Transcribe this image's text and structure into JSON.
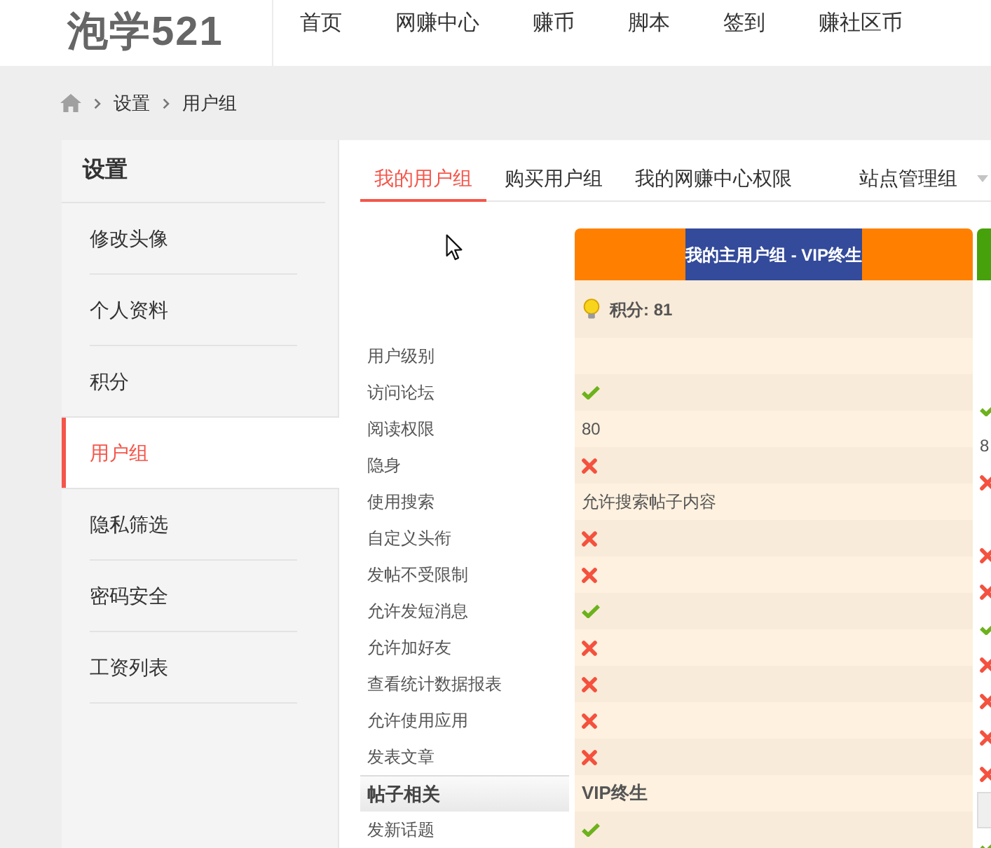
{
  "header": {
    "logo": "泡学521",
    "nav": [
      "首页",
      "网赚中心",
      "赚币",
      "脚本",
      "签到",
      "赚社区币"
    ]
  },
  "breadcrumb": [
    "设置",
    "用户组"
  ],
  "sidebar": {
    "title": "设置",
    "items": [
      {
        "label": "修改头像",
        "selected": false
      },
      {
        "label": "个人资料",
        "selected": false
      },
      {
        "label": "积分",
        "selected": false
      },
      {
        "label": "用户组",
        "selected": true
      },
      {
        "label": "隐私筛选",
        "selected": false
      },
      {
        "label": "密码安全",
        "selected": false
      },
      {
        "label": "工资列表",
        "selected": false
      }
    ]
  },
  "tabs": [
    {
      "label": "我的用户组",
      "selected": true,
      "kind": "tab"
    },
    {
      "label": "购买用户组",
      "selected": false,
      "kind": "tab"
    },
    {
      "label": "我的网赚中心权限",
      "selected": false,
      "kind": "tab"
    },
    {
      "label": "站点管理组",
      "selected": false,
      "kind": "dropdown"
    }
  ],
  "table": {
    "groups": [
      {
        "title": "我的主用户组 - VIP终生",
        "color": "#ff8000",
        "points": "积分: 81"
      },
      {
        "color": "#46a10a"
      }
    ],
    "rows": [
      {
        "label": "用户级别",
        "kind": "item",
        "cells": [
          {
            "kind": "blank"
          },
          {
            "kind": "blank"
          }
        ]
      },
      {
        "label": "访问论坛",
        "kind": "item",
        "cells": [
          {
            "kind": "check"
          },
          {
            "kind": "check"
          }
        ]
      },
      {
        "label": "阅读权限",
        "kind": "item",
        "cells": [
          {
            "kind": "text",
            "text": "80"
          },
          {
            "kind": "text",
            "text": "8"
          }
        ]
      },
      {
        "label": "隐身",
        "kind": "item",
        "cells": [
          {
            "kind": "cross"
          },
          {
            "kind": "cross"
          }
        ]
      },
      {
        "label": "使用搜索",
        "kind": "item",
        "cells": [
          {
            "kind": "text",
            "text": "允许搜索帖子内容"
          },
          {
            "kind": "blank"
          }
        ]
      },
      {
        "label": "自定义头衔",
        "kind": "item",
        "cells": [
          {
            "kind": "cross"
          },
          {
            "kind": "cross"
          }
        ]
      },
      {
        "label": "发帖不受限制",
        "kind": "item",
        "cells": [
          {
            "kind": "cross"
          },
          {
            "kind": "cross"
          }
        ]
      },
      {
        "label": "允许发短消息",
        "kind": "item",
        "cells": [
          {
            "kind": "check"
          },
          {
            "kind": "check"
          }
        ]
      },
      {
        "label": "允许加好友",
        "kind": "item",
        "cells": [
          {
            "kind": "cross"
          },
          {
            "kind": "cross"
          }
        ]
      },
      {
        "label": "查看统计数据报表",
        "kind": "item",
        "cells": [
          {
            "kind": "cross"
          },
          {
            "kind": "cross"
          }
        ]
      },
      {
        "label": "允许使用应用",
        "kind": "item",
        "cells": [
          {
            "kind": "cross"
          },
          {
            "kind": "cross"
          }
        ]
      },
      {
        "label": "发表文章",
        "kind": "item",
        "cells": [
          {
            "kind": "cross"
          },
          {
            "kind": "cross"
          }
        ]
      },
      {
        "label": "帖子相关",
        "kind": "section",
        "cells": [
          {
            "kind": "text",
            "text": "VIP终生"
          },
          {
            "kind": "blank"
          }
        ]
      },
      {
        "label": "发新话题",
        "kind": "item",
        "cells": [
          {
            "kind": "check"
          },
          {
            "kind": "check"
          }
        ]
      }
    ]
  }
}
